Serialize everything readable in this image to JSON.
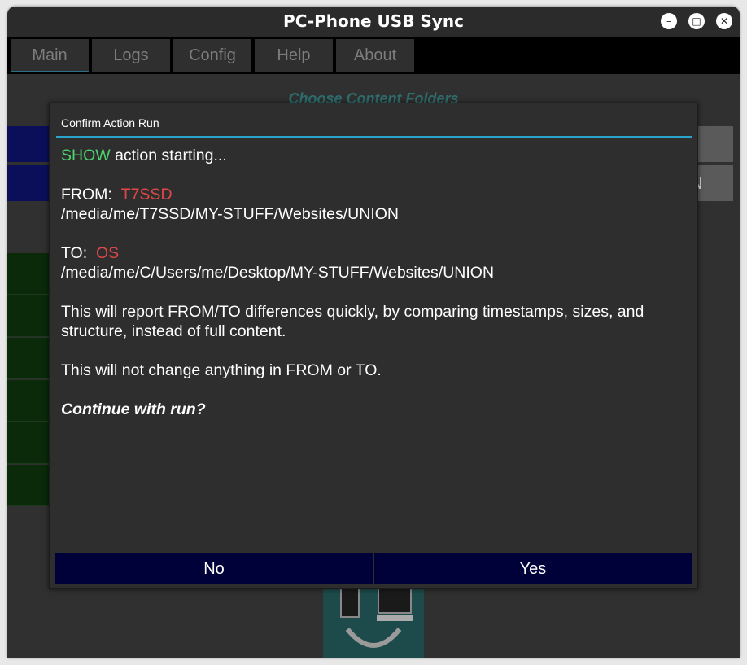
{
  "window": {
    "title": "PC-Phone USB Sync",
    "controls": [
      "minimize-icon",
      "maximize-icon",
      "close-icon"
    ],
    "minimize_glyph": "–",
    "maximize_glyph": "□",
    "close_glyph": "✕"
  },
  "tabs": [
    {
      "label": "Main",
      "active": true
    },
    {
      "label": "Logs",
      "active": false
    },
    {
      "label": "Config",
      "active": false
    },
    {
      "label": "Help",
      "active": false
    },
    {
      "label": "About",
      "active": false
    }
  ],
  "background": {
    "heading": "Choose Content Folders",
    "partial_button_text": "N"
  },
  "dialog": {
    "title": "Confirm Action Run",
    "action_name": "SHOW",
    "action_suffix": " action starting...",
    "from_label": "FROM:",
    "from_device": "T7SSD",
    "from_path": "/media/me/T7SSD/MY-STUFF/Websites/UNION",
    "to_label": "TO:",
    "to_device": "OS",
    "to_path": "/media/me/C/Users/me/Desktop/MY-STUFF/Websites/UNION",
    "description": "This will report FROM/TO differences quickly, by comparing timestamps, sizes, and structure, instead of full content.",
    "note": "This will not change anything in FROM or TO.",
    "prompt": "Continue with run?",
    "no_label": "No",
    "yes_label": "Yes"
  },
  "colors": {
    "accent": "#2aa4c9",
    "action_green": "#4ed46e",
    "device_red": "#e04848",
    "button_navy": "#01013a"
  }
}
